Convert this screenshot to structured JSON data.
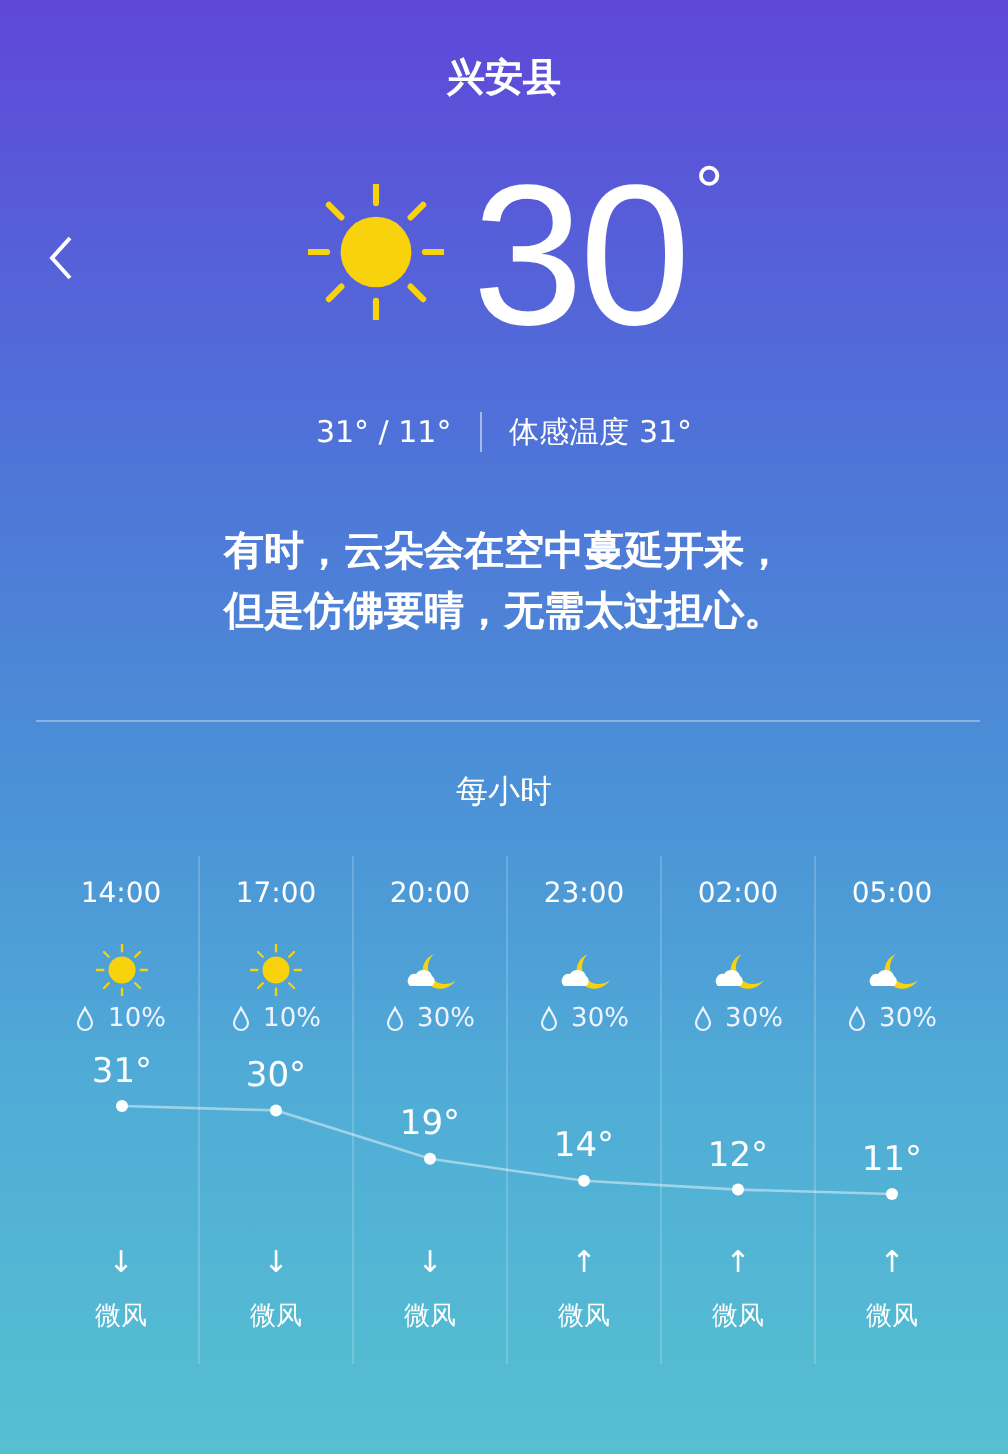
{
  "header": {
    "title": "兴安县"
  },
  "current": {
    "kind": "sun",
    "temperature": "30",
    "unit": "°",
    "high_low": "31° / 11°",
    "feels_like": "体感温度 31°"
  },
  "message": [
    "有时，云朵会在空中蔓延开来，",
    "但是仿佛要晴，无需太过担心。"
  ],
  "hourly": {
    "title": "每小时",
    "hours": [
      {
        "time": "14:00",
        "kind": "sun",
        "rain": "10%",
        "temp": "31°",
        "wind_arrow": "↓",
        "wind": "微风"
      },
      {
        "time": "17:00",
        "kind": "sun",
        "rain": "10%",
        "temp": "30°",
        "wind_arrow": "↓",
        "wind": "微风"
      },
      {
        "time": "20:00",
        "kind": "moon-cloud",
        "rain": "30%",
        "temp": "19°",
        "wind_arrow": "↓",
        "wind": "微风"
      },
      {
        "time": "23:00",
        "kind": "moon-cloud",
        "rain": "30%",
        "temp": "14°",
        "wind_arrow": "↑",
        "wind": "微风"
      },
      {
        "time": "02:00",
        "kind": "moon-cloud",
        "rain": "30%",
        "temp": "12°",
        "wind_arrow": "↑",
        "wind": "微风"
      },
      {
        "time": "05:00",
        "kind": "moon-cloud",
        "rain": "30%",
        "temp": "11°",
        "wind_arrow": "↑",
        "wind": "微风"
      }
    ]
  }
}
